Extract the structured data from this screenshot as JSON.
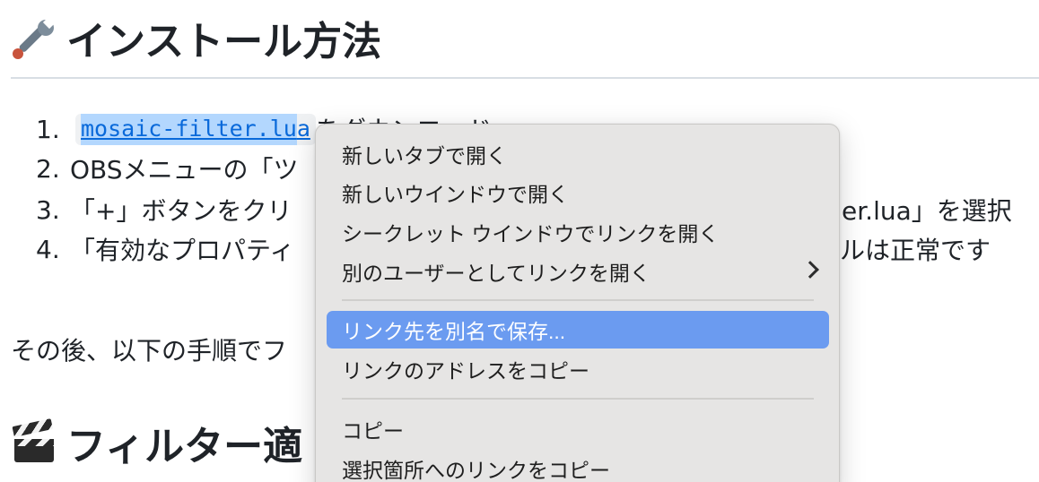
{
  "heading1": {
    "icon": "wrench-icon",
    "text": "インストール方法"
  },
  "steps": [
    {
      "num": "1.",
      "link_text_selected": "mosaic-filter.lu",
      "link_text_rest": "a",
      "after": "をダウンロード"
    },
    {
      "num": "2.",
      "text": "OBSメニューの「ツ"
    },
    {
      "num": "3.",
      "text": "「+」ボタンをクリ",
      "tail": "er.lua」を選択"
    },
    {
      "num": "4.",
      "text": "「有効なプロパティ",
      "tail": "ルは正常です"
    }
  ],
  "paragraph": "その後、以下の手順でフ",
  "heading2": {
    "icon": "clapper-board-icon",
    "text": "フィルター適"
  },
  "context_menu": {
    "items": [
      {
        "label": "新しいタブで開く"
      },
      {
        "label": "新しいウインドウで開く"
      },
      {
        "label": "シークレット ウインドウでリンクを開く"
      },
      {
        "label": "別のユーザーとしてリンクを開く",
        "submenu": true
      },
      {
        "label": "リンク先を別名で保存...",
        "highlighted": true
      },
      {
        "label": "リンクのアドレスをコピー"
      },
      {
        "label": "コピー"
      },
      {
        "label": "選択箇所へのリンクをコピー"
      }
    ]
  },
  "colors": {
    "link": "#0969da",
    "selection": "#b3d7fe",
    "menu_highlight": "#6b9bf0",
    "menu_background": "#e6e5e4"
  }
}
